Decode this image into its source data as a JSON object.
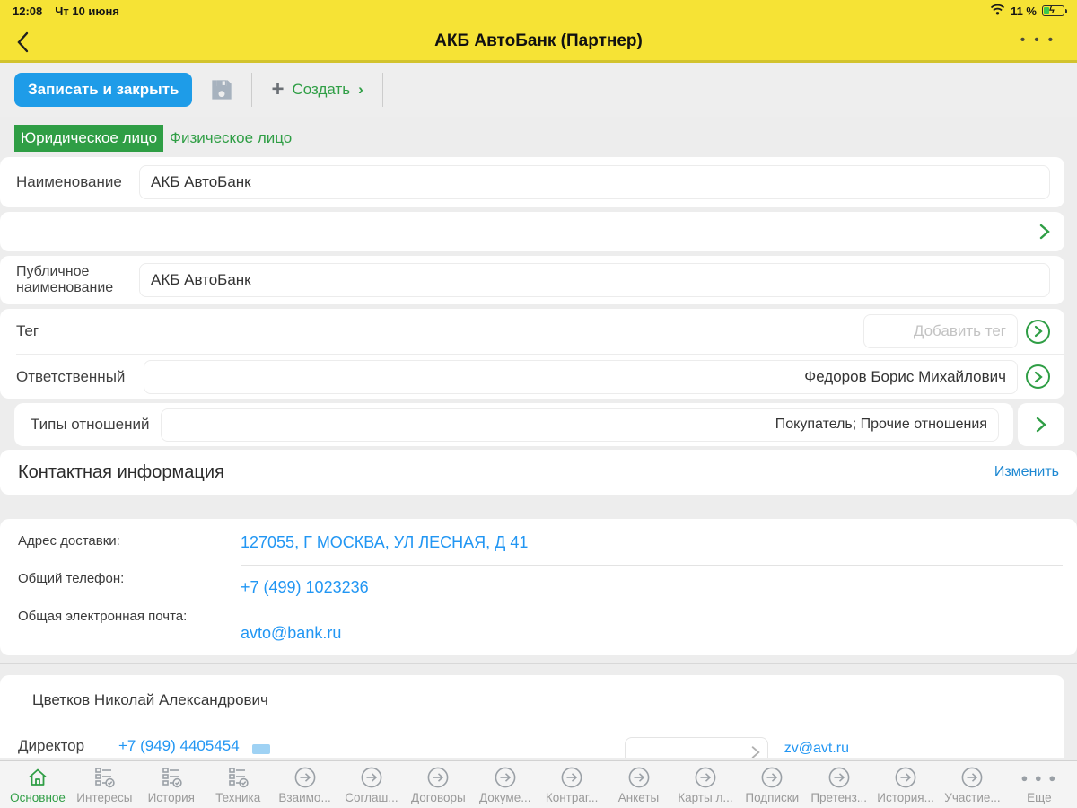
{
  "colors": {
    "accent_yellow": "#f6e335",
    "accent_green": "#2f9e45",
    "accent_blue": "#1e9ce8",
    "link_blue": "#2196f3"
  },
  "status_bar": {
    "time": "12:08",
    "date": "Чт 10 июня",
    "battery_percent": "11 %"
  },
  "nav": {
    "title": "АКБ АвтоБанк (Партнер)",
    "menu_dots": "• • •"
  },
  "toolbar": {
    "save_close_label": "Записать и закрыть",
    "create_label": "Создать",
    "create_chevron": "›",
    "plus": "+"
  },
  "tabs": [
    {
      "label": "Юридическое лицо",
      "active": true
    },
    {
      "label": "Физическое лицо",
      "active": false
    }
  ],
  "fields": {
    "name": {
      "label": "Наименование",
      "value": "АКБ АвтоБанк"
    },
    "public_name": {
      "label": "Публичное наименование",
      "value": "АКБ АвтоБанк"
    },
    "tag": {
      "label": "Тег",
      "placeholder": "Добавить тег"
    },
    "responsible": {
      "label": "Ответственный",
      "value": "Федоров Борис Михайлович"
    },
    "relation_types": {
      "label": "Типы отношений",
      "value": "Покупатель; Прочие отношения"
    }
  },
  "contact": {
    "header": "Контактная информация",
    "edit_label": "Изменить",
    "rows": [
      {
        "label": "Адрес доставки:",
        "value": "127055, Г МОСКВА, УЛ ЛЕСНАЯ, Д 41"
      },
      {
        "label": "Общий телефон:",
        "value": "+7 (499) 1023236"
      },
      {
        "label": "Общая электронная почта:",
        "value": "avto@bank.ru"
      }
    ]
  },
  "director": {
    "person": "Цветков Николай Александрович",
    "role_label": "Директор",
    "phone": "+7 (949) 4405454",
    "email": "zv@avt.ru"
  },
  "footer": {
    "items": [
      {
        "label": "Основное",
        "icon": "home-icon",
        "active": true
      },
      {
        "label": "Интересы",
        "icon": "doc-check-icon",
        "active": false
      },
      {
        "label": "История",
        "icon": "doc-check-icon",
        "active": false
      },
      {
        "label": "Техника",
        "icon": "doc-check-icon",
        "active": false
      },
      {
        "label": "Взаимо...",
        "icon": "circle-arrow-icon",
        "active": false
      },
      {
        "label": "Соглаш...",
        "icon": "circle-arrow-icon",
        "active": false
      },
      {
        "label": "Договоры",
        "icon": "circle-arrow-icon",
        "active": false
      },
      {
        "label": "Докуме...",
        "icon": "circle-arrow-icon",
        "active": false
      },
      {
        "label": "Контраг...",
        "icon": "circle-arrow-icon",
        "active": false
      },
      {
        "label": "Анкеты",
        "icon": "circle-arrow-icon",
        "active": false
      },
      {
        "label": "Карты л...",
        "icon": "circle-arrow-icon",
        "active": false
      },
      {
        "label": "Подписки",
        "icon": "circle-arrow-icon",
        "active": false
      },
      {
        "label": "Претенз...",
        "icon": "circle-arrow-icon",
        "active": false
      },
      {
        "label": "История...",
        "icon": "circle-arrow-icon",
        "active": false
      },
      {
        "label": "Участие...",
        "icon": "circle-arrow-icon",
        "active": false
      },
      {
        "label": "Еще",
        "icon": "dots-icon",
        "active": false
      }
    ]
  }
}
